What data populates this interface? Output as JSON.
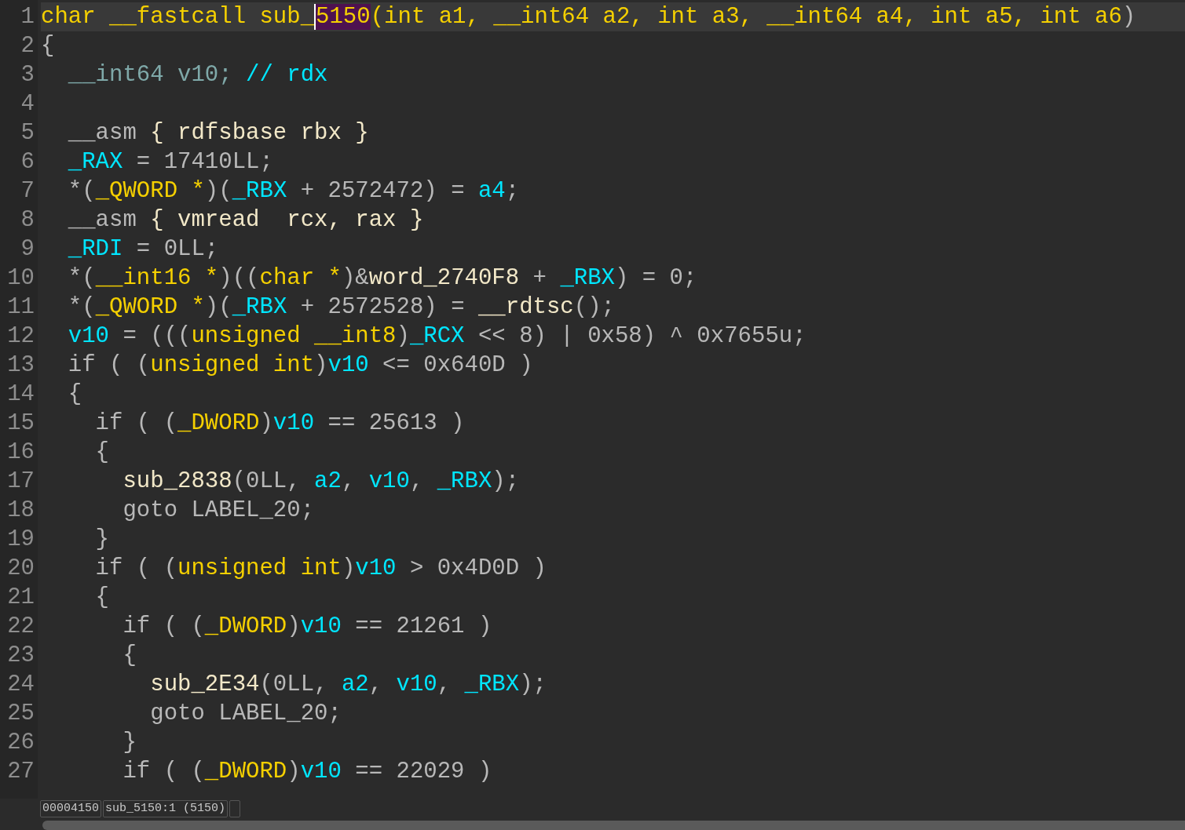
{
  "code_lines": [
    {
      "number": "1",
      "current": true,
      "tokens": [
        {
          "kind": "type",
          "text": "char __fastcall sub_"
        },
        {
          "kind": "highlight",
          "text": "5150"
        },
        {
          "kind": "type",
          "text": "(int a1, __int64 a2, int a3, __int64 a4, int a5, int a6"
        },
        {
          "kind": "plain",
          "text": ")"
        }
      ]
    },
    {
      "number": "2",
      "current": false,
      "tokens": [
        {
          "kind": "plain",
          "text": "{"
        }
      ]
    },
    {
      "number": "3",
      "current": false,
      "tokens": [
        {
          "kind": "decl",
          "text": "  __int64 v10;"
        },
        {
          "kind": "comment",
          "text": " // rdx"
        }
      ]
    },
    {
      "number": "4",
      "current": false
    },
    {
      "number": "5",
      "current": false,
      "tokens": [
        {
          "kind": "plain",
          "text": "  __asm"
        },
        {
          "kind": "asm",
          "text": " { rdfsbase rbx }"
        }
      ]
    },
    {
      "number": "6",
      "current": false,
      "tokens": [
        {
          "kind": "name",
          "text": "  _RAX"
        },
        {
          "kind": "plain",
          "text": " = 17410LL;"
        }
      ]
    },
    {
      "number": "7",
      "current": false,
      "tokens": [
        {
          "kind": "plain",
          "text": "  *("
        },
        {
          "kind": "type",
          "text": "_QWORD *"
        },
        {
          "kind": "plain",
          "text": ")("
        },
        {
          "kind": "name",
          "text": "_RBX"
        },
        {
          "kind": "plain",
          "text": " + 2572472) = "
        },
        {
          "kind": "name",
          "text": "a4"
        },
        {
          "kind": "plain",
          "text": ";"
        }
      ]
    },
    {
      "number": "8",
      "current": false,
      "tokens": [
        {
          "kind": "plain",
          "text": "  __asm"
        },
        {
          "kind": "asm",
          "text": " { vmread  rcx, rax }"
        }
      ]
    },
    {
      "number": "9",
      "current": false,
      "tokens": [
        {
          "kind": "name",
          "text": "  _RDI"
        },
        {
          "kind": "plain",
          "text": " = 0LL;"
        }
      ]
    },
    {
      "number": "10",
      "current": false,
      "tokens": [
        {
          "kind": "plain",
          "text": "  *("
        },
        {
          "kind": "type",
          "text": "__int16 *"
        },
        {
          "kind": "plain",
          "text": ")(("
        },
        {
          "kind": "type",
          "text": "char *"
        },
        {
          "kind": "plain",
          "text": ")&"
        },
        {
          "kind": "asm",
          "text": "word_2740F8"
        },
        {
          "kind": "plain",
          "text": " + "
        },
        {
          "kind": "name",
          "text": "_RBX"
        },
        {
          "kind": "plain",
          "text": ") = 0;"
        }
      ]
    },
    {
      "number": "11",
      "current": false,
      "tokens": [
        {
          "kind": "plain",
          "text": "  *("
        },
        {
          "kind": "type",
          "text": "_QWORD *"
        },
        {
          "kind": "plain",
          "text": ")("
        },
        {
          "kind": "name",
          "text": "_RBX"
        },
        {
          "kind": "plain",
          "text": " + 2572528) = "
        },
        {
          "kind": "asm",
          "text": "__rdtsc"
        },
        {
          "kind": "plain",
          "text": "();"
        }
      ]
    },
    {
      "number": "12",
      "current": false,
      "tokens": [
        {
          "kind": "name",
          "text": "  v10"
        },
        {
          "kind": "plain",
          "text": " = ((("
        },
        {
          "kind": "type",
          "text": "unsigned __int8"
        },
        {
          "kind": "plain",
          "text": ")"
        },
        {
          "kind": "name",
          "text": "_RCX"
        },
        {
          "kind": "plain",
          "text": " << 8) | 0x58) ^ 0x7655u;"
        }
      ]
    },
    {
      "number": "13",
      "current": false,
      "tokens": [
        {
          "kind": "plain",
          "text": "  if ( ("
        },
        {
          "kind": "type",
          "text": "unsigned int"
        },
        {
          "kind": "plain",
          "text": ")"
        },
        {
          "kind": "name",
          "text": "v10"
        },
        {
          "kind": "plain",
          "text": " <= 0x640D )"
        }
      ]
    },
    {
      "number": "14",
      "current": false,
      "tokens": [
        {
          "kind": "plain",
          "text": "  {"
        }
      ]
    },
    {
      "number": "15",
      "current": false,
      "tokens": [
        {
          "kind": "plain",
          "text": "    if ( ("
        },
        {
          "kind": "type",
          "text": "_DWORD"
        },
        {
          "kind": "plain",
          "text": ")"
        },
        {
          "kind": "name",
          "text": "v10"
        },
        {
          "kind": "plain",
          "text": " == 25613 )"
        }
      ]
    },
    {
      "number": "16",
      "current": false,
      "tokens": [
        {
          "kind": "plain",
          "text": "    {"
        }
      ]
    },
    {
      "number": "17",
      "current": false,
      "tokens": [
        {
          "kind": "asm",
          "text": "      sub_2838"
        },
        {
          "kind": "plain",
          "text": "(0LL, "
        },
        {
          "kind": "name",
          "text": "a2"
        },
        {
          "kind": "plain",
          "text": ", "
        },
        {
          "kind": "name",
          "text": "v10"
        },
        {
          "kind": "plain",
          "text": ", "
        },
        {
          "kind": "name",
          "text": "_RBX"
        },
        {
          "kind": "plain",
          "text": ");"
        }
      ]
    },
    {
      "number": "18",
      "current": false,
      "tokens": [
        {
          "kind": "plain",
          "text": "      goto LABEL_20;"
        }
      ]
    },
    {
      "number": "19",
      "current": false,
      "tokens": [
        {
          "kind": "plain",
          "text": "    }"
        }
      ]
    },
    {
      "number": "20",
      "current": false,
      "tokens": [
        {
          "kind": "plain",
          "text": "    if ( ("
        },
        {
          "kind": "type",
          "text": "unsigned int"
        },
        {
          "kind": "plain",
          "text": ")"
        },
        {
          "kind": "name",
          "text": "v10"
        },
        {
          "kind": "plain",
          "text": " > 0x4D0D )"
        }
      ]
    },
    {
      "number": "21",
      "current": false,
      "tokens": [
        {
          "kind": "plain",
          "text": "    {"
        }
      ]
    },
    {
      "number": "22",
      "current": false,
      "tokens": [
        {
          "kind": "plain",
          "text": "      if ( ("
        },
        {
          "kind": "type",
          "text": "_DWORD"
        },
        {
          "kind": "plain",
          "text": ")"
        },
        {
          "kind": "name",
          "text": "v10"
        },
        {
          "kind": "plain",
          "text": " == 21261 )"
        }
      ]
    },
    {
      "number": "23",
      "current": false,
      "tokens": [
        {
          "kind": "plain",
          "text": "      {"
        }
      ]
    },
    {
      "number": "24",
      "current": false,
      "tokens": [
        {
          "kind": "asm",
          "text": "        sub_2E34"
        },
        {
          "kind": "plain",
          "text": "(0LL, "
        },
        {
          "kind": "name",
          "text": "a2"
        },
        {
          "kind": "plain",
          "text": ", "
        },
        {
          "kind": "name",
          "text": "v10"
        },
        {
          "kind": "plain",
          "text": ", "
        },
        {
          "kind": "name",
          "text": "_RBX"
        },
        {
          "kind": "plain",
          "text": ");"
        }
      ]
    },
    {
      "number": "25",
      "current": false,
      "tokens": [
        {
          "kind": "plain",
          "text": "        goto LABEL_20;"
        }
      ]
    },
    {
      "number": "26",
      "current": false,
      "tokens": [
        {
          "kind": "plain",
          "text": "      }"
        }
      ]
    },
    {
      "number": "27",
      "current": false,
      "tokens": [
        {
          "kind": "plain",
          "text": "      if ( ("
        },
        {
          "kind": "type",
          "text": "_DWORD"
        },
        {
          "kind": "plain",
          "text": ")"
        },
        {
          "kind": "name",
          "text": "v10"
        },
        {
          "kind": "plain",
          "text": " == 22029 )"
        }
      ]
    }
  ],
  "status_bar": {
    "address": "00004150",
    "location": "sub_5150:1 (5150)"
  }
}
